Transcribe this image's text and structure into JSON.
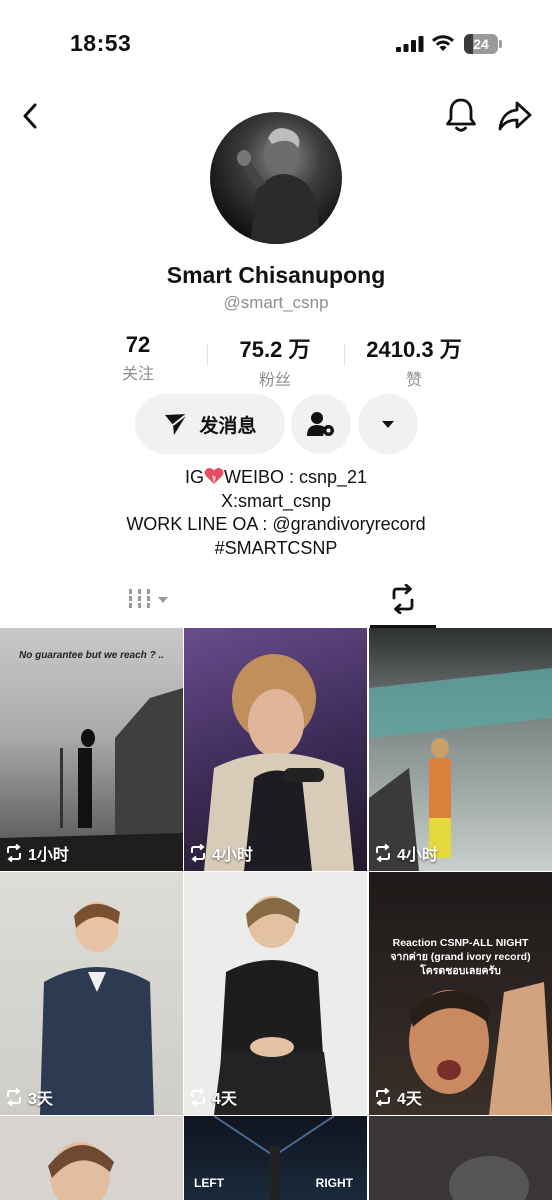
{
  "status_bar": {
    "time": "18:53",
    "battery": "24"
  },
  "profile": {
    "name": "Smart Chisanupong",
    "handle": "@smart_csnp"
  },
  "stats": [
    {
      "value": "72",
      "label": "关注"
    },
    {
      "value": "75.2 万",
      "label": "粉丝"
    },
    {
      "value": "2410.3 万",
      "label": "赞"
    }
  ],
  "actions": {
    "message_label": "发消息"
  },
  "bio": {
    "line1_prefix": "IG",
    "line1_suffix": "WEIBO : csnp_21",
    "line2": "X:smart_csnp",
    "line3": "WORK LINE OA : @grandivoryrecord",
    "line4": "#SMARTCSNP"
  },
  "videos": [
    {
      "time": "1小时",
      "caption": "No guarantee but we reach ? ..",
      "bg": "#8d8d8d"
    },
    {
      "time": "4小时",
      "caption": "",
      "bg": "#5a3a55"
    },
    {
      "time": "4小时",
      "caption": "",
      "bg": "#6d7a78"
    },
    {
      "time": "3天",
      "caption": "",
      "bg": "#d8d6d2"
    },
    {
      "time": "4天",
      "caption": "",
      "bg": "#e8e8e6"
    },
    {
      "time": "4天",
      "caption": "Reaction CSNP-ALL NIGHT\nจากค่าย (grand ivory record)\nโครตชอบเลยครับ",
      "bg": "#2a2321"
    }
  ],
  "partial_row": {
    "left_label": "LEFT",
    "right_label": "RIGHT"
  }
}
